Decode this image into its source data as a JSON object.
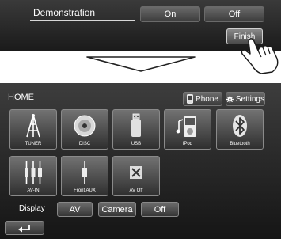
{
  "demo": {
    "label": "Demonstration",
    "on_label": "On",
    "off_label": "Off",
    "finish_label": "Finish"
  },
  "home": {
    "title": "HOME",
    "phone_label": "Phone",
    "settings_label": "Settings",
    "tiles": [
      {
        "label": "TUNER",
        "icon": "antenna-icon"
      },
      {
        "label": "DISC",
        "icon": "disc-icon"
      },
      {
        "label": "USB",
        "icon": "usb-icon"
      },
      {
        "label": "iPod",
        "icon": "ipod-icon"
      },
      {
        "label": "Bluetooth",
        "icon": "bluetooth-icon"
      },
      {
        "label": "AV-IN",
        "icon": "av-in-icon"
      },
      {
        "label": "Front AUX",
        "icon": "front-aux-icon"
      },
      {
        "label": "AV Off",
        "icon": "av-off-icon"
      }
    ],
    "display": {
      "label": "Display",
      "options": [
        "AV",
        "Camera",
        "Off"
      ]
    }
  }
}
